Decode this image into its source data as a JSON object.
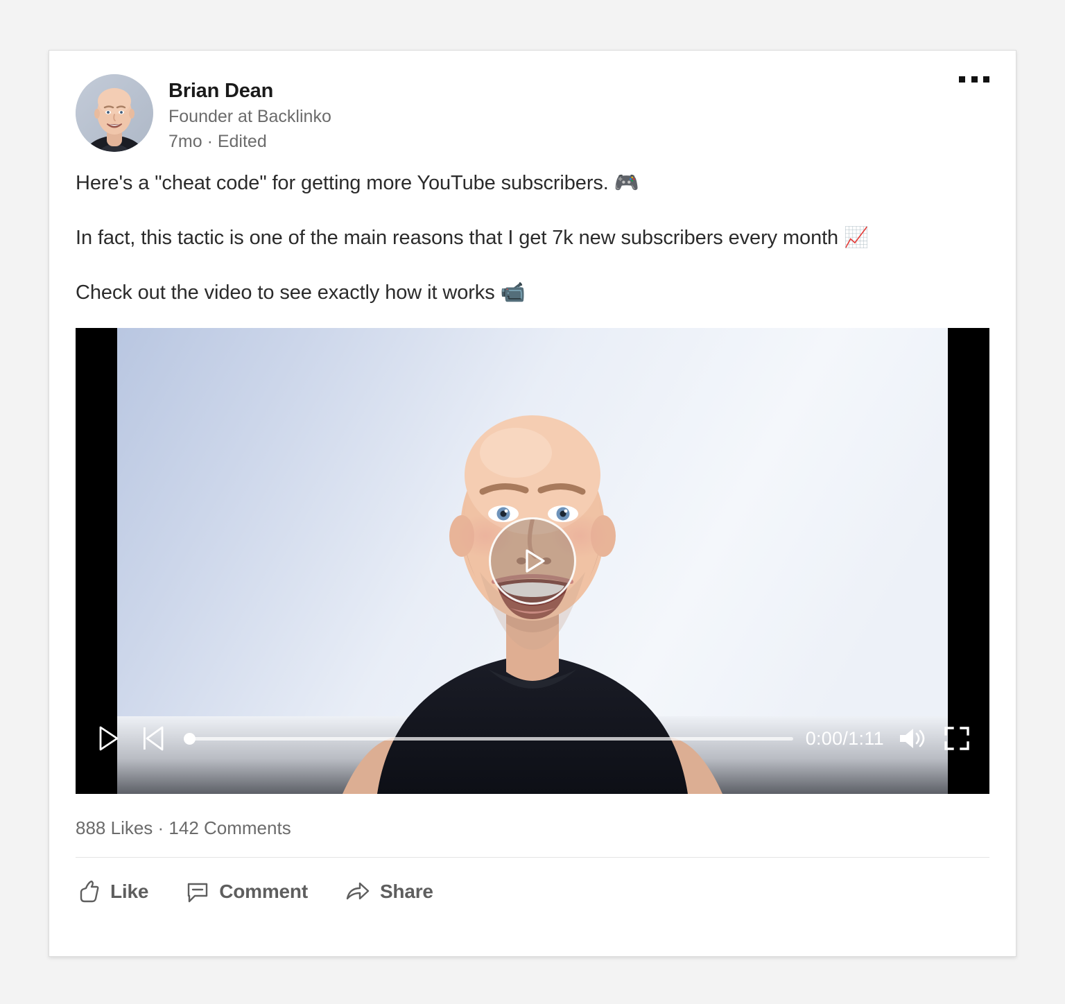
{
  "post": {
    "author": {
      "name": "Brian Dean",
      "headline": "Founder at Backlinko",
      "meta": "7mo · Edited",
      "avatar_alt": "Brian Dean profile photo"
    },
    "more_menu_label": "More options",
    "paragraphs": [
      "Here's a \"cheat code\" for getting more YouTube subscribers. 🎮",
      "In fact, this tactic is one of the main reasons that I get 7k new subscribers every month 📈",
      "Check out the video to see exactly how it works 📹"
    ],
    "video": {
      "current_time": "0:00",
      "duration": "1:11",
      "time_display": "0:00/1:11",
      "progress_percent": 0,
      "play_label": "Play",
      "previous_label": "Previous",
      "volume_label": "Volume",
      "fullscreen_label": "Fullscreen",
      "play_overlay_label": "Play video"
    },
    "social": {
      "likes": "888 Likes",
      "separator": "·",
      "comments": "142 Comments",
      "summary": "888 Likes · 142 Comments"
    },
    "actions": [
      {
        "id": "like",
        "label": "Like",
        "icon": "thumbs-up-icon"
      },
      {
        "id": "comment",
        "label": "Comment",
        "icon": "speech-bubble-icon"
      },
      {
        "id": "share",
        "label": "Share",
        "icon": "share-arrow-icon"
      }
    ]
  },
  "colors": {
    "page_background": "#f3f3f3",
    "card_background": "#ffffff",
    "card_border": "#dcdcdc",
    "primary_text": "#2b2b2b",
    "secondary_text": "#6b6b6b",
    "action_text": "#5e5e5e",
    "video_letterbox": "#000000",
    "control_foreground": "#ffffff"
  }
}
